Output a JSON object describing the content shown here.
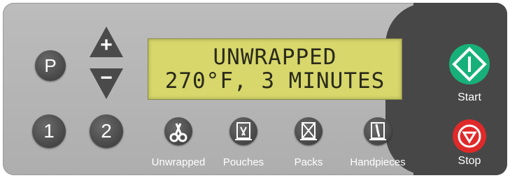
{
  "display": {
    "line1": "UNWRAPPED",
    "line2": "270°F, 3 MINUTES"
  },
  "keys": {
    "program": "P",
    "up": "+",
    "down": "−",
    "preset1": "1",
    "preset2": "2"
  },
  "modes": {
    "unwrapped": "Unwrapped",
    "pouches": "Pouches",
    "packs": "Packs",
    "handpieces": "Handpieces"
  },
  "controls": {
    "start": "Start",
    "stop": "Stop"
  },
  "colors": {
    "panel": "#b4b4b4",
    "dark_panel": "#474747",
    "lcd": "#d7d76b",
    "start": "#18b07a",
    "stop": "#e02a2a"
  }
}
